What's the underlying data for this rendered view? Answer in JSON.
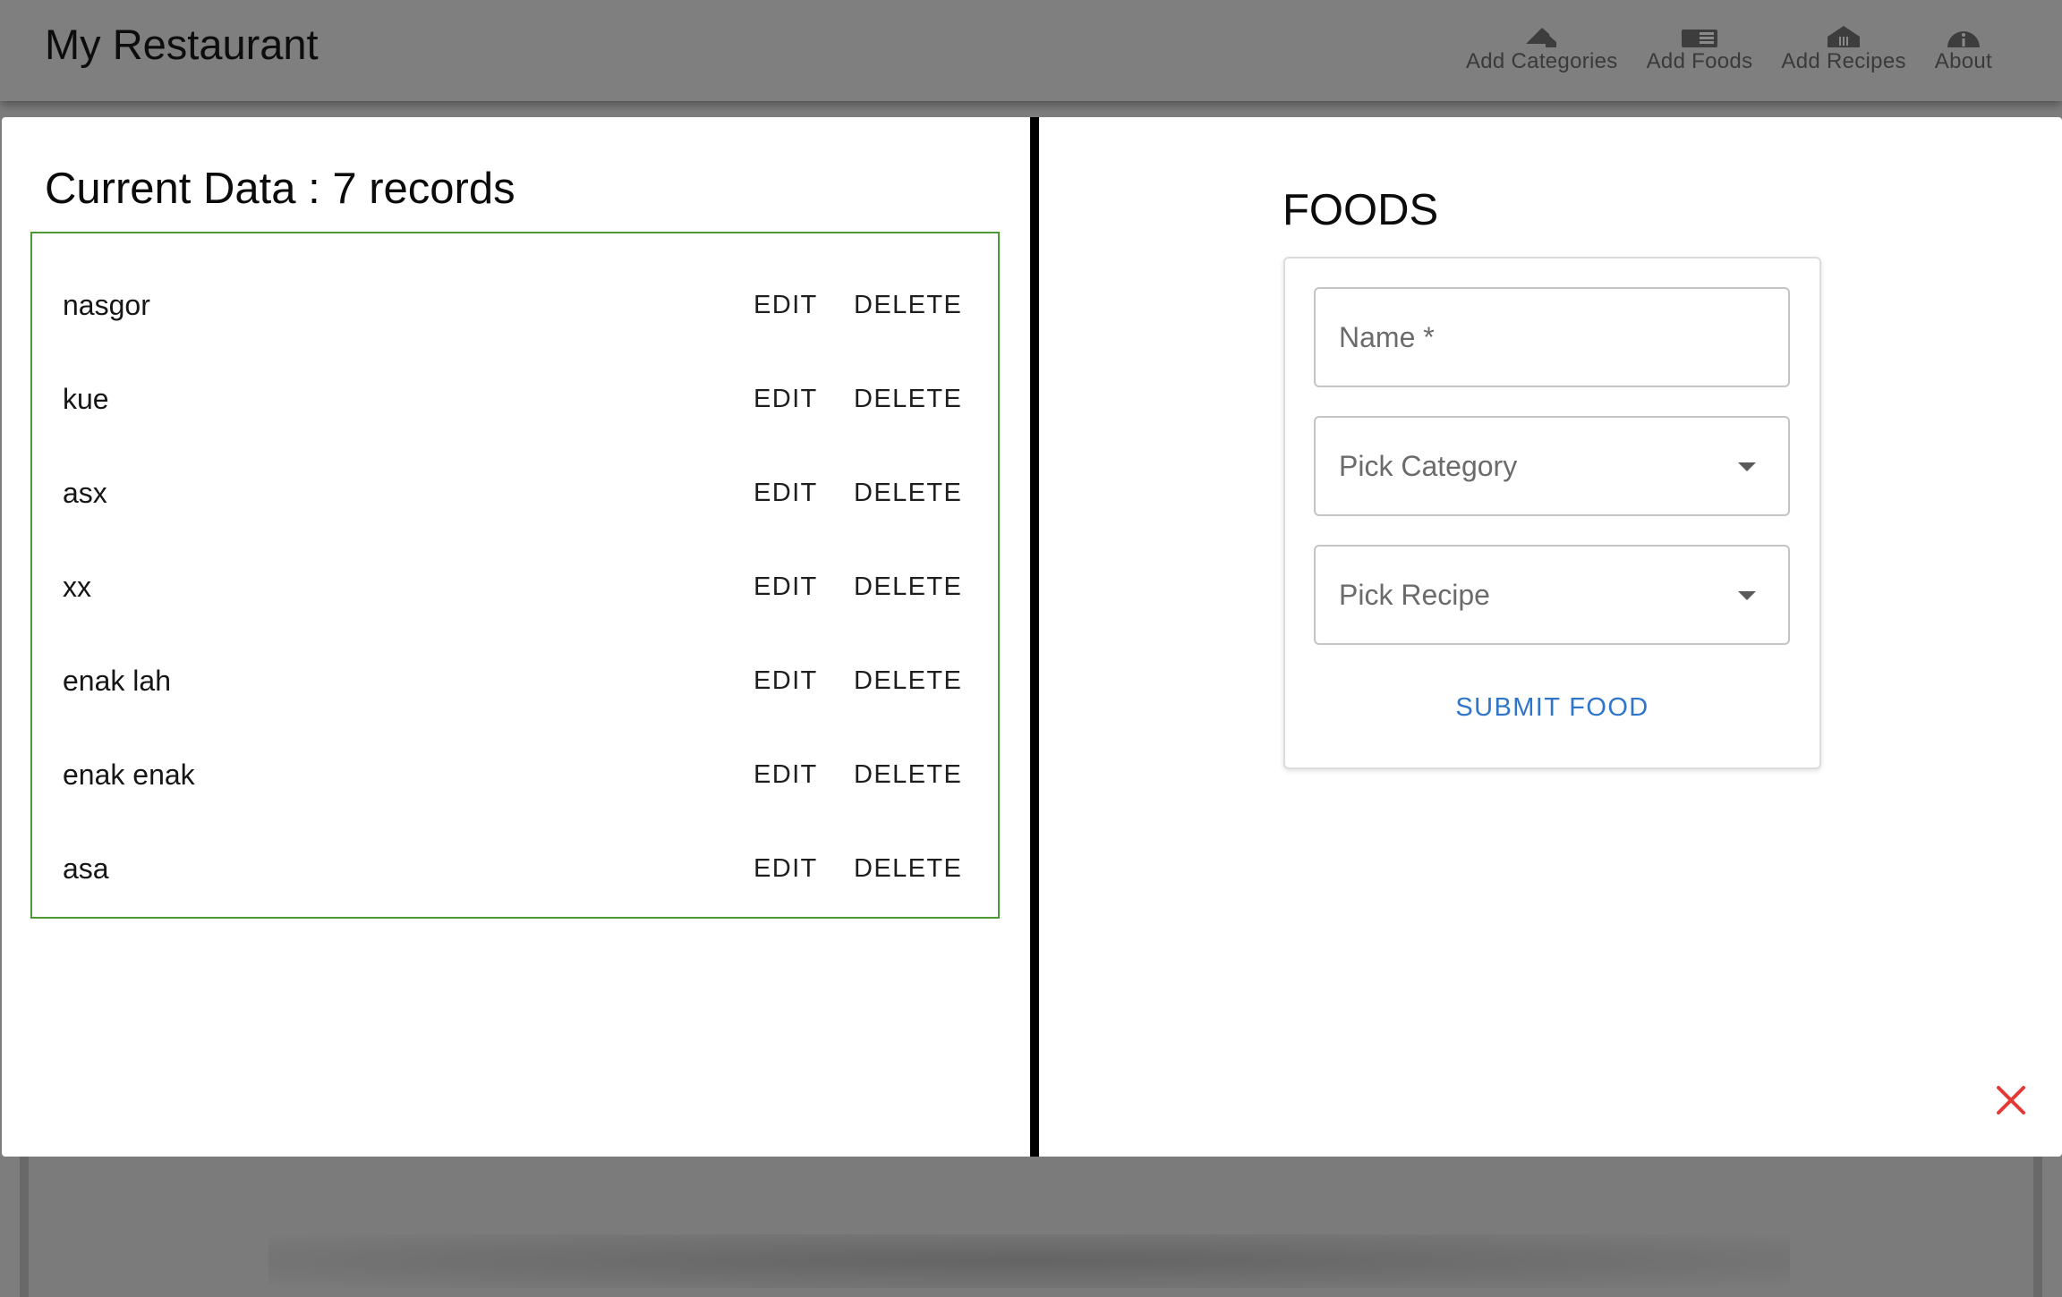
{
  "appbar": {
    "title": "My Restaurant",
    "nav": [
      {
        "label": "Add Categories",
        "icon": "home-roof-icon"
      },
      {
        "label": "Add Foods",
        "icon": "menu-book-icon"
      },
      {
        "label": "Add Recipes",
        "icon": "restaurant-icon"
      },
      {
        "label": "About",
        "icon": "info-icon"
      }
    ]
  },
  "records": {
    "title": "Current Data : 7 records",
    "edit_label": "EDIT",
    "delete_label": "DELETE",
    "items": [
      {
        "name": "nasgor"
      },
      {
        "name": "kue"
      },
      {
        "name": "asx"
      },
      {
        "name": "xx"
      },
      {
        "name": "enak lah"
      },
      {
        "name": "enak enak"
      },
      {
        "name": "asa"
      }
    ]
  },
  "form": {
    "title": "FOODS",
    "name_label": "Name *",
    "category_label": "Pick Category",
    "recipe_label": "Pick Recipe",
    "submit_label": "SUBMIT FOOD"
  },
  "colors": {
    "accent": "#2f76c9",
    "border_green": "#4c9a35",
    "close_red": "#e53935",
    "appbar_bg": "#7f7f7f"
  }
}
